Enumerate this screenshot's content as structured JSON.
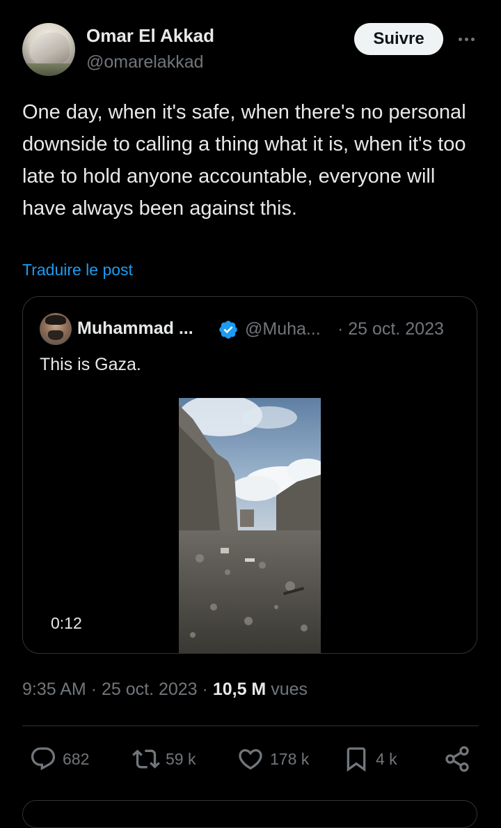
{
  "author": {
    "name": "Omar El Akkad",
    "handle": "@omarelakkad",
    "follow_label": "Suivre"
  },
  "post": {
    "text": "One day, when it's safe, when there's no personal downside to calling a thing what it is, when it's too late to hold anyone accountable, everyone will have always been against this.",
    "translate_label": "Traduire le post"
  },
  "quoted_post": {
    "name": "Muhammad ...",
    "handle": "@Muha...",
    "date": "· 25 oct. 2023",
    "text": "This is Gaza.",
    "video_duration": "0:12",
    "verified": true
  },
  "meta": {
    "time": "9:35 AM",
    "separator": "·",
    "date": "25 oct. 2023",
    "views_count": "10,5 M",
    "views_label": "vues"
  },
  "actions": {
    "replies": "682",
    "reposts": "59 k",
    "likes": "178 k",
    "bookmarks": "4 k"
  },
  "icons": [
    "more-icon",
    "verified-badge-icon",
    "reply-icon",
    "repost-icon",
    "like-icon",
    "bookmark-icon",
    "share-icon"
  ],
  "colors": {
    "background": "#000000",
    "text": "#e7e9ea",
    "muted": "#71767b",
    "link": "#1d9bf0",
    "border": "#2f3336",
    "verified": "#1d9bf0"
  }
}
